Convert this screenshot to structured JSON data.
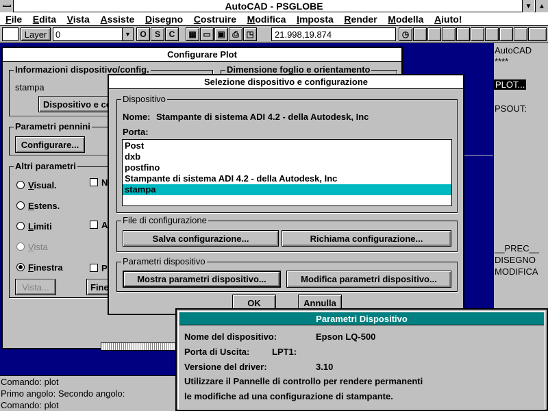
{
  "window": {
    "title": "AutoCAD - PSGLOBE"
  },
  "menu": {
    "items": [
      "File",
      "Edita",
      "Vista",
      "Assiste",
      "Disegno",
      "Costruire",
      "Modifica",
      "Imposta",
      "Render",
      "Modella",
      "Aiuto!"
    ]
  },
  "toolbar": {
    "layer_label": "Layer",
    "layer_value": "0",
    "o_label": "O",
    "s_label": "S",
    "c_label": "C",
    "coords": "21.998,19.874"
  },
  "screen_menu": {
    "title": "AutoCAD",
    "stars": "****",
    "plot": "PLOT...",
    "psout": "PSOUT:",
    "prec": "__PREC__",
    "disegno": "DISEGNO",
    "modifica": "MODIFICA"
  },
  "command_lines": [
    "Comando: plot",
    "Primo angolo: Secondo angolo:",
    "Comando: plot"
  ],
  "plot_dialog": {
    "title": "Configurare Plot",
    "info_group": "Informazioni dispositivo/config.",
    "device_name": "stampa",
    "device_button": "Dispositivo e configurazione...",
    "paper_group": "Dimensione foglio e orientamento",
    "pen_group": "Parametri pennini",
    "config_button": "Configurare...",
    "other_group": "Altri parametri",
    "radios": [
      "Visual.",
      "Estens.",
      "Limiti",
      "Vista",
      "Finestra"
    ],
    "checks": [
      "N",
      "A",
      "P"
    ],
    "vista_button": "Vista...",
    "finestra_button": "Finestra..."
  },
  "device_dialog": {
    "title": "Selezione dispositivo e configurazione",
    "device_group": "Dispositivo",
    "name_label": "Nome:",
    "name_value": "Stampante di sistema ADI 4.2 - della Autodesk, Inc",
    "port_label": "Porta:",
    "ports": [
      "Post",
      "dxb",
      "postfino",
      "Stampante di sistema ADI 4.2 - della Autodesk, Inc",
      "stampa"
    ],
    "selected_port": "stampa",
    "config_group": "File di configurazione",
    "save_button": "Salva configurazione...",
    "load_button": "Richiama configurazione...",
    "params_group": "Parametri dispositivo",
    "show_button": "Mostra parametri dispositivo...",
    "edit_button": "Modifica parametri dispositivo...",
    "ok_button": "OK",
    "cancel_button": "Annulla"
  },
  "params_dialog": {
    "title": "Parametri Dispositivo",
    "device_label": "Nome del dispositivo:",
    "device_value": "Epson LQ-500",
    "port_label": "Porta di Uscita:",
    "port_value": "LPT1:",
    "driver_label": "Versione del driver:",
    "driver_value": "3.10",
    "note_line1": "Utilizzare il Pannelle di controllo per rendere permanenti",
    "note_line2": "le modifiche ad una configurazione di stampante."
  }
}
